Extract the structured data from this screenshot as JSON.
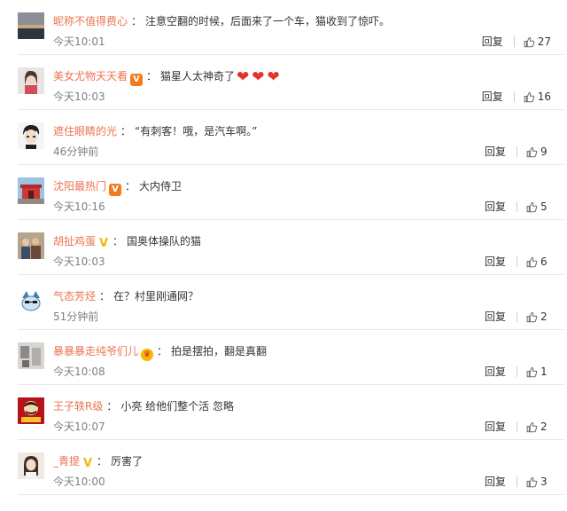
{
  "reply_label": "回复",
  "comments": [
    {
      "user": "昵称不值得费心",
      "badge": "",
      "text": "注意空翻的时候，后面来了一个车，猫收到了惊吓。",
      "hearts": "",
      "time": "今天10:01",
      "likes": "27",
      "avatar": "dusk-landscape"
    },
    {
      "user": "美女尤物天天看",
      "badge": "V",
      "text": "猫星人太神奇了",
      "hearts": "❤❤❤",
      "time": "今天10:03",
      "likes": "16",
      "avatar": "woman-portrait"
    },
    {
      "user": "遮住眼睛的光",
      "badge": "",
      "text": "“有刺客！哦，是汽车啊。”",
      "hearts": "",
      "time": "46分钟前",
      "likes": "9",
      "avatar": "anime-boy"
    },
    {
      "user": "沈阳最热门",
      "badge": "V",
      "text": "大内侍卫",
      "hearts": "",
      "time": "今天10:16",
      "likes": "5",
      "avatar": "red-gate"
    },
    {
      "user": "胡扯鸡蛋",
      "badge": "V",
      "text": "国奥体操队的猫",
      "hearts": "",
      "time": "今天10:03",
      "likes": "6",
      "avatar": "group-photo"
    },
    {
      "user": "气态芳烃",
      "badge": "",
      "text": "在？村里刚通网？",
      "hearts": "",
      "time": "51分钟前",
      "likes": "2",
      "avatar": "cartoon-cat"
    },
    {
      "user": "暴暴暴走纯爷们儿",
      "badge": "crown",
      "text": "拍是摆拍，翻是真翻",
      "hearts": "",
      "time": "今天10:08",
      "likes": "1",
      "avatar": "room-photo"
    },
    {
      "user": "王子轶R级",
      "badge": "",
      "text": "小亮 给他们整个活 忽略",
      "hearts": "",
      "time": "今天10:07",
      "likes": "2",
      "avatar": "pringles-logo"
    },
    {
      "user": "_青提",
      "badge": "V",
      "text": "厉害了",
      "hearts": "",
      "time": "今天10:00",
      "likes": "3",
      "avatar": "girl-portrait"
    }
  ],
  "colors": {
    "username": "#eb7350",
    "muted": "#808080",
    "text": "#333333",
    "separator": "#e8e8e8"
  }
}
